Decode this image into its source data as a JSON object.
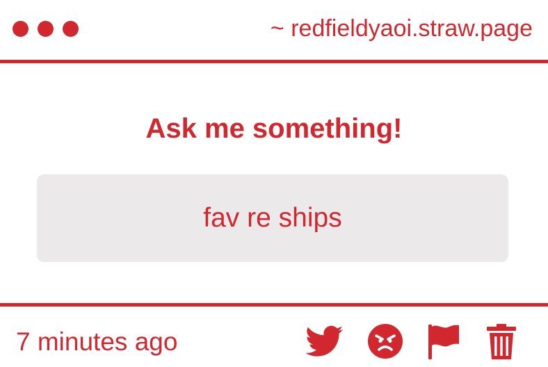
{
  "titlebar": {
    "url": "~ redfieldyaoi.straw.page"
  },
  "main": {
    "heading": "Ask me something!",
    "question": "fav re ships"
  },
  "footer": {
    "timestamp": "7 minutes ago",
    "actions": [
      {
        "icon": "twitter-icon"
      },
      {
        "icon": "angry-face-icon"
      },
      {
        "icon": "flag-icon"
      },
      {
        "icon": "trash-icon"
      }
    ]
  },
  "colors": {
    "accent": "#d1282f",
    "question_bg": "#ebe9ea",
    "background": "#ffffff"
  }
}
